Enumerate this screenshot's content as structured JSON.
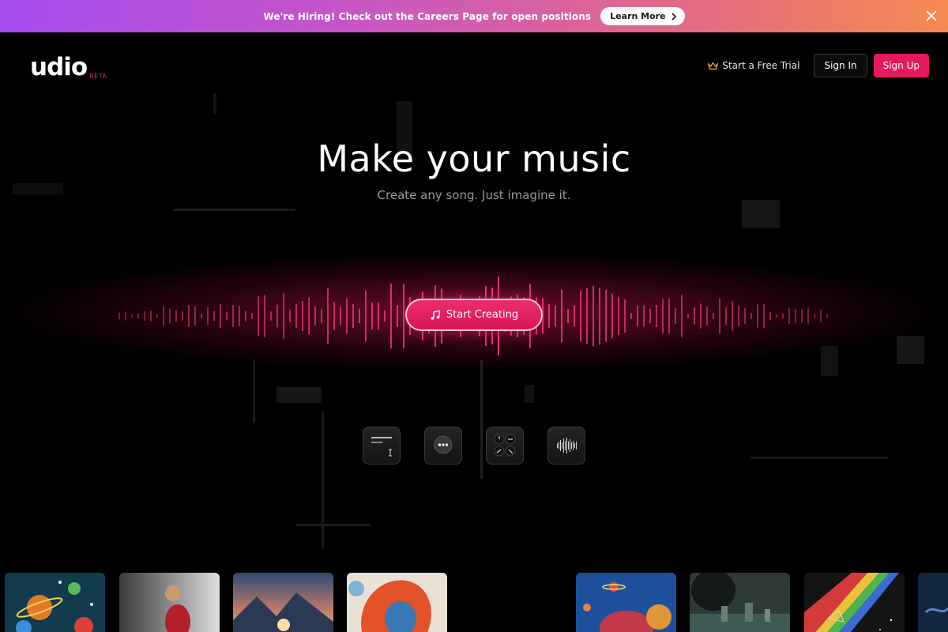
{
  "banner": {
    "text": "We're Hiring! Check out the Careers Page for open positions",
    "button_label": "Learn More",
    "background_colors": [
      "#a44bf0",
      "#c555c8",
      "#e2688a",
      "#f48a50"
    ]
  },
  "header": {
    "logo_text": "udio",
    "logo_badge": "BETA",
    "free_trial_label": "Start a Free Trial",
    "sign_in_label": "Sign In",
    "sign_up_label": "Sign Up",
    "accent_color": "#e5195e"
  },
  "hero": {
    "title": "Make your music",
    "subtitle": "Create any song. Just imagine it.",
    "cta_label": "Start Creating"
  },
  "features": [
    {
      "icon": "text-prompt-icon"
    },
    {
      "icon": "chat-bubble-icon"
    },
    {
      "icon": "control-knobs-icon"
    },
    {
      "icon": "audio-waveform-icon"
    }
  ],
  "thumbnails": [
    {
      "icon": "cover-art-planets"
    },
    {
      "icon": "cover-art-blurred-figure"
    },
    {
      "icon": "cover-art-mountain-sunset"
    },
    {
      "icon": "cover-art-red-hair-portrait"
    },
    {
      "icon": "cover-art-space-planets"
    },
    {
      "icon": "cover-art-night-city"
    },
    {
      "icon": "cover-art-rainbow-prism"
    },
    {
      "icon": "cover-art-partial"
    }
  ]
}
